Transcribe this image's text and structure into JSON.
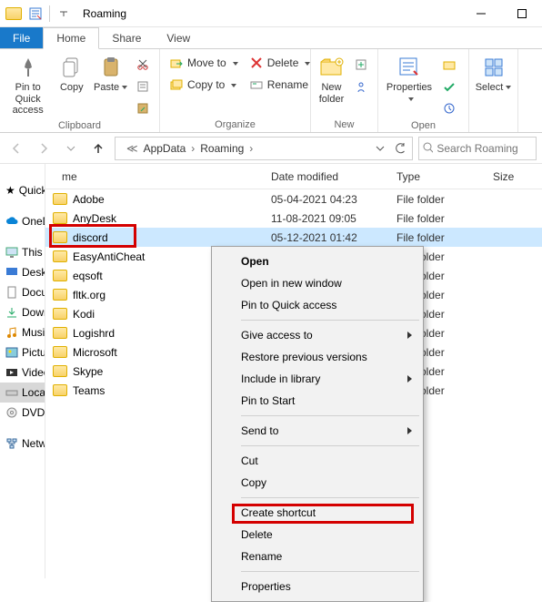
{
  "window": {
    "title": "Roaming"
  },
  "tabs": {
    "file": "File",
    "home": "Home",
    "share": "Share",
    "view": "View"
  },
  "ribbon": {
    "clipboard": {
      "label": "Clipboard",
      "pin": "Pin to Quick access",
      "copy": "Copy",
      "paste": "Paste"
    },
    "organize": {
      "label": "Organize",
      "moveto": "Move to",
      "copyto": "Copy to",
      "delete": "Delete",
      "rename": "Rename"
    },
    "new": {
      "label": "New",
      "newfolder": "New folder"
    },
    "open": {
      "label": "Open",
      "properties": "Properties"
    },
    "select": {
      "label": "Select"
    }
  },
  "breadcrumb": {
    "seg1": "AppData",
    "seg2": "Roaming"
  },
  "search": {
    "placeholder": "Search Roaming"
  },
  "columns": {
    "name": "me",
    "date": "Date modified",
    "type": "Type",
    "size": "Size"
  },
  "typeFolder": "File folder",
  "items": [
    {
      "name": "Adobe",
      "date": "05-04-2021 04:23"
    },
    {
      "name": "AnyDesk",
      "date": "11-08-2021 09:05"
    },
    {
      "name": "discord",
      "date": "05-12-2021 01:42"
    },
    {
      "name": "EasyAntiCheat",
      "date": ""
    },
    {
      "name": "eqsoft",
      "date": ""
    },
    {
      "name": "fltk.org",
      "date": ""
    },
    {
      "name": "Kodi",
      "date": ""
    },
    {
      "name": "Logishrd",
      "date": ""
    },
    {
      "name": "Microsoft",
      "date": ""
    },
    {
      "name": "Skype",
      "date": ""
    },
    {
      "name": "Teams",
      "date": ""
    }
  ],
  "navpane": {
    "quick": "Quick access",
    "onedrive": "OneDrive",
    "thispc": "This PC",
    "desktop": "Desktop",
    "documents": "Documents",
    "downloads": "Downloads",
    "music": "Music",
    "pictures": "Pictures",
    "videos": "Videos",
    "localdisk": "Local Disk",
    "dvd": "DVD Drive",
    "network": "Network"
  },
  "ctx": {
    "open": "Open",
    "openNew": "Open in new window",
    "pin": "Pin to Quick access",
    "giveAccess": "Give access to",
    "restore": "Restore previous versions",
    "include": "Include in library",
    "pinStart": "Pin to Start",
    "sendTo": "Send to",
    "cut": "Cut",
    "copy": "Copy",
    "shortcut": "Create shortcut",
    "delete": "Delete",
    "rename": "Rename",
    "properties": "Properties"
  }
}
